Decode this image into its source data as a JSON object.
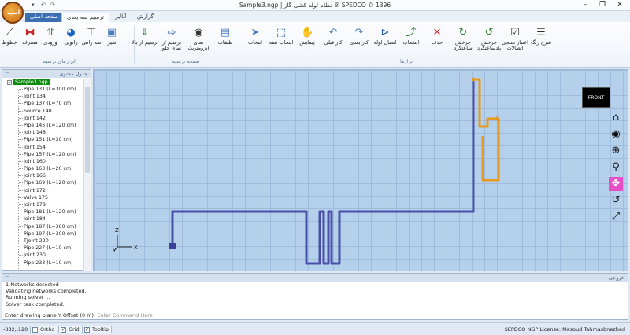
{
  "window": {
    "title": "Sample3.ngp | نظام لوله کشی گاز  ® SPEDCO © 1396",
    "logo_text": "اسپد",
    "controls": [
      "–",
      "❐",
      "✕"
    ]
  },
  "quick_access": [
    "▾",
    "↶",
    "↷"
  ],
  "tabs": [
    "صفحه اصلی",
    "ترسیم سه بعدی",
    "آنالیز",
    "گزارش"
  ],
  "ribbon": {
    "groups": {
      "drawing_tools": "ابزارهای ترسیم",
      "drawing_page": "صفحه ترسیم",
      "tools": "ابزارها"
    },
    "left_buttons": [
      {
        "label": "خطوط",
        "icon": "line-icon",
        "color": "#333333"
      },
      {
        "label": "مصرف",
        "icon": "valve-red-icon",
        "color": "#c62828"
      },
      {
        "label": "ورودی",
        "icon": "inlet-icon",
        "color": "#2e7d32"
      },
      {
        "label": "زانویی",
        "icon": "elbow-icon",
        "color": "#1565c0"
      },
      {
        "label": "سه راهی",
        "icon": "tee-icon",
        "color": "#555555"
      },
      {
        "label": "شیر",
        "icon": "valve-icon",
        "color": "#4a7bbf"
      }
    ],
    "page_buttons": [
      {
        "label": "ترسیم از بالا",
        "icon": "download-arrow-icon",
        "color": "#2e7d32"
      },
      {
        "label": "ترسیم از نمای جلو",
        "icon": "arrow-right-box-icon",
        "color": "#1e5aa8"
      },
      {
        "label": "نمای ایزومتریک",
        "icon": "eye-icon",
        "color": "#333333"
      },
      {
        "label": "طبقات",
        "icon": "layers-icon",
        "color": "#4a7bbf"
      }
    ],
    "tool_buttons": [
      {
        "label": "انتخاب",
        "icon": "cursor-icon",
        "color": "#4a7bbf"
      },
      {
        "label": "انتخاب همه",
        "icon": "select-all-icon",
        "color": "#1e5aa8"
      },
      {
        "label": "پیمایش",
        "icon": "hand-icon",
        "color": "#e0a020"
      },
      {
        "label": "کار قبلی",
        "icon": "undo-icon",
        "color": "#4a7bbf"
      },
      {
        "label": "کار بعدی",
        "icon": "redo-icon",
        "color": "#4a7bbf"
      },
      {
        "label": "اتصال لوله",
        "icon": "connect-icon",
        "color": "#1e5aa8"
      },
      {
        "label": "انشعاب",
        "icon": "branch-icon",
        "color": "#2e7d32"
      },
      {
        "label": "حذف",
        "icon": "delete-icon",
        "color": "#d32f2f"
      },
      {
        "label": "چرخش ساعتگرد",
        "icon": "rotate-cw-icon",
        "color": "#2e7d32"
      },
      {
        "label": "چرخش پادساعتگرد",
        "icon": "rotate-ccw-icon",
        "color": "#2e7d32"
      },
      {
        "label": "اعتبار سنجی اتصالات",
        "icon": "checklist-icon",
        "color": "#333333"
      },
      {
        "label": "شرح رنگ",
        "icon": "color-legend-icon",
        "color": "#333333"
      }
    ]
  },
  "tree_panel": {
    "title": "جدول محتوی",
    "root": "Sample3.ngp",
    "items": [
      "Pipe 131 (L=300 cm)",
      "Joint 134",
      "Pipe 137 (L=70 cm)",
      "Source 140",
      "Joint 142",
      "Pipe 145 (L=120 cm)",
      "Joint 148",
      "Pipe 151 (L=30 cm)",
      "Joint 154",
      "Pipe 157 (L=120 cm)",
      "Joint 160",
      "Pipe 163 (L=20 cm)",
      "Joint 166",
      "Pipe 169 (L=120 cm)",
      "Joint 172",
      "Valve 175",
      "Joint 178",
      "Pipe 181 (L=120 cm)",
      "Joint 184",
      "Pipe 187 (L=300 cm)",
      "Pipe 197 (L=300 cm)",
      "TJoint 220",
      "Pipe 227 (L=10 cm)",
      "Joint 230",
      "Pipe 233 (L=10 cm)"
    ]
  },
  "canvas": {
    "view_cube": "FRONT",
    "axis_labels": {
      "z": "Z",
      "x": "X",
      "y": "Y"
    },
    "colors": {
      "grid_bg": "#b5d0eb",
      "pipe_blue": "#4a4fa8",
      "pipe_orange": "#e69a22"
    },
    "nav_icons": [
      "home-icon",
      "look-icon",
      "zoom-window-icon",
      "zoom-icon",
      "pan-icon",
      "rotate-icon",
      "fit-icon"
    ]
  },
  "output": {
    "title": "خروجی",
    "lines": [
      "1 Networks detected",
      "Validating networks completed.",
      "Running solver ...",
      "Solver task completed."
    ],
    "command_label": "Enter drawing plane Y Offset (0 m):",
    "command_placeholder": "Enter Command Here"
  },
  "status": {
    "coords": "-382,,120",
    "ortho": "Ortho",
    "grid": "Grid",
    "tooltip": "Tooltip",
    "license": "SEPDCO NGP License:  Masoud Tahmasbnezhad"
  }
}
